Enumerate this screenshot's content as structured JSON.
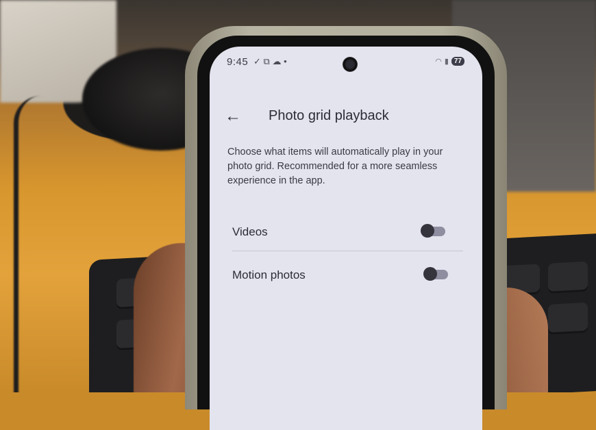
{
  "status_bar": {
    "time": "9:45",
    "icons": [
      "check-icon",
      "screenshot-icon",
      "cloud-icon",
      "dot-icon"
    ],
    "battery": "77"
  },
  "app_bar": {
    "title": "Photo grid playback"
  },
  "description": "Choose what items will automatically play in your photo grid. Recommended for a more seamless experience in the app.",
  "settings": [
    {
      "label": "Videos",
      "enabled": false
    },
    {
      "label": "Motion photos",
      "enabled": false
    }
  ],
  "colors": {
    "screen_bg": "#e4e4ef",
    "toggle_track": "#8f8da0",
    "toggle_knob": "#35333c",
    "text": "#2c2c36"
  }
}
